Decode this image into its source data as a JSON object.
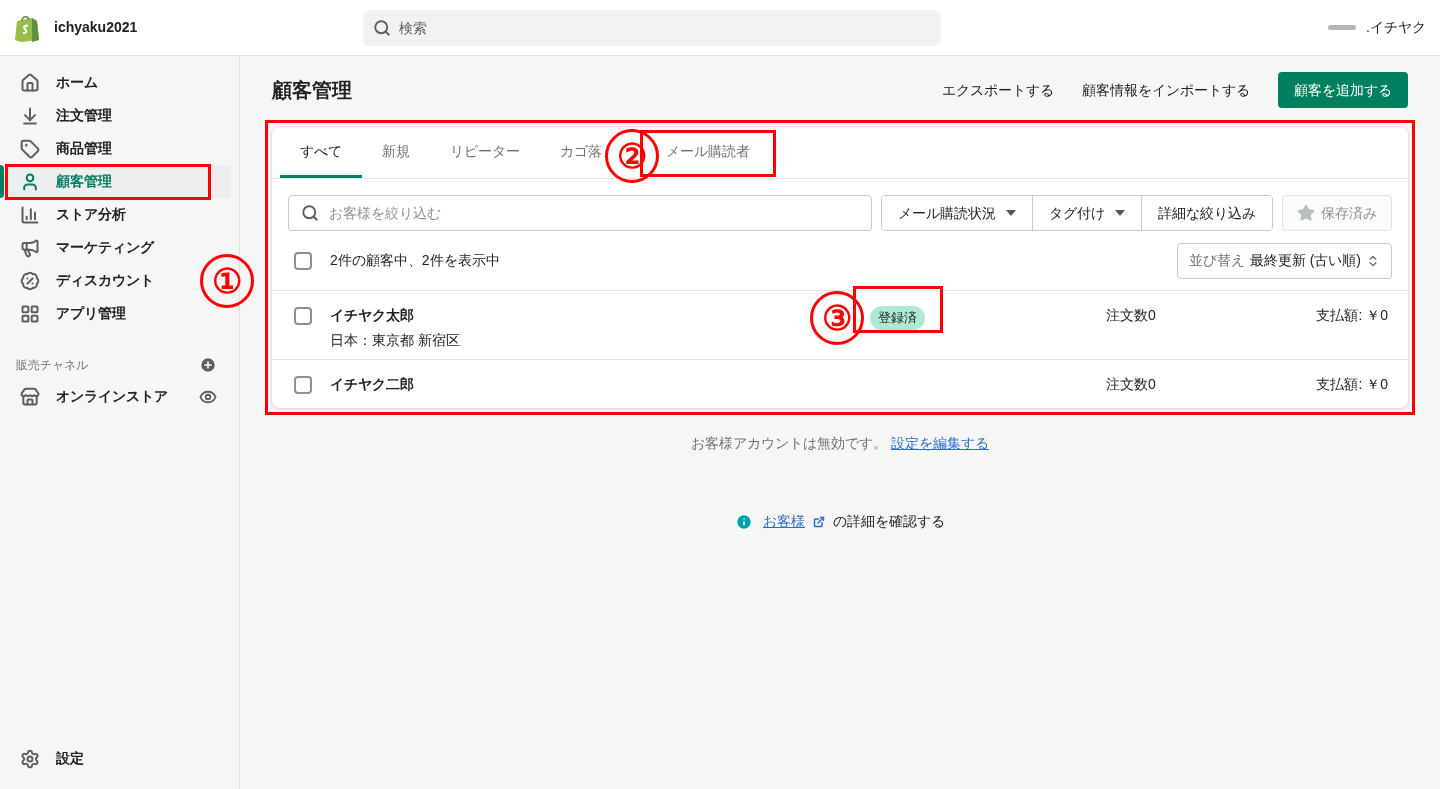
{
  "store": {
    "name": "ichyaku2021"
  },
  "search": {
    "placeholder": "検索"
  },
  "account": {
    "name": ".イチヤク"
  },
  "sidebar": {
    "items": [
      {
        "label": "ホーム",
        "selected": false,
        "annotated": false
      },
      {
        "label": "注文管理",
        "selected": false,
        "annotated": false
      },
      {
        "label": "商品管理",
        "selected": false,
        "annotated": false
      },
      {
        "label": "顧客管理",
        "selected": true,
        "annotated": true
      },
      {
        "label": "ストア分析",
        "selected": false,
        "annotated": false
      },
      {
        "label": "マーケティング",
        "selected": false,
        "annotated": false
      },
      {
        "label": "ディスカウント",
        "selected": false,
        "annotated": false
      },
      {
        "label": "アプリ管理",
        "selected": false,
        "annotated": false
      }
    ],
    "channels_heading": "販売チャネル",
    "channels": [
      {
        "label": "オンラインストア"
      }
    ],
    "settings": "設定"
  },
  "page": {
    "title": "顧客管理",
    "actions": [
      "エクスポートする",
      "顧客情報をインポートする"
    ],
    "primary_action": "顧客を追加する"
  },
  "card": {
    "annotated": true,
    "tabs": [
      {
        "label": "すべて",
        "selected": true,
        "annotated": false
      },
      {
        "label": "新規",
        "selected": false,
        "annotated": false
      },
      {
        "label": "リピーター",
        "selected": false,
        "annotated": false
      },
      {
        "label": "カゴ落",
        "selected": false,
        "annotated": false
      },
      {
        "label": "メール購読者",
        "selected": false,
        "annotated": true
      }
    ],
    "filter": {
      "placeholder": "お客様を絞り込む"
    },
    "filter_buttons": [
      {
        "label": "メール購読状況",
        "dropdown": true
      },
      {
        "label": "タグ付け",
        "dropdown": true
      },
      {
        "label": "詳細な絞り込み",
        "dropdown": false
      }
    ],
    "saved": {
      "label": "保存済み",
      "disabled": true
    },
    "summary": "2件の顧客中、2件を表示中",
    "select_all_checked": false,
    "sort": {
      "label": "並び替え",
      "value": "最終更新 (古い順)"
    },
    "rows": [
      {
        "name": "イチヤク太郎",
        "location": "日本：東京都 新宿区",
        "badge": {
          "label": "登録済",
          "annotated": true
        },
        "orders": "注文数0",
        "spent": "支払額: ￥0",
        "checked": false
      },
      {
        "name": "イチヤク二郎",
        "orders": "注文数0",
        "spent": "支払額: ￥0",
        "checked": false
      }
    ]
  },
  "notice": {
    "text": "お客様アカウントは無効です。",
    "link": "設定を編集する"
  },
  "help": {
    "link": "お客様",
    "text": "の詳細を確認する"
  },
  "markers": [
    {
      "text": "①"
    },
    {
      "text": "②"
    },
    {
      "text": "③"
    }
  ]
}
